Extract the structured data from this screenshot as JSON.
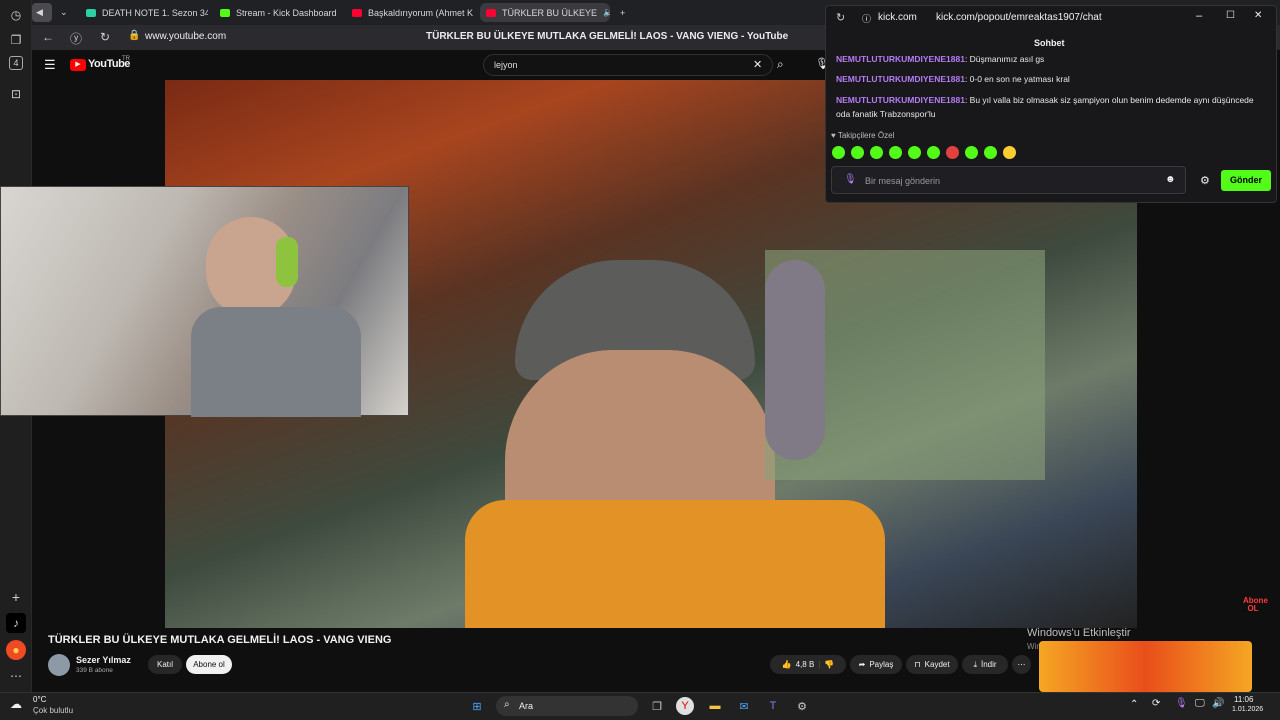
{
  "colors": {
    "yt_red": "#ff0000",
    "kick_green": "#53fc18",
    "chat_user": "#b57cf5"
  },
  "tabs": [
    {
      "label": "DEATH NOTE 1. Sezon 34",
      "icon": "death-note-tab-icon",
      "color": "#2bd1a2"
    },
    {
      "label": "Stream - Kick Dashboard",
      "icon": "kick-icon",
      "color": "#53fc18"
    },
    {
      "label": "Başkaldırıyorum (Ahmet K",
      "icon": "youtube-icon",
      "color": "#ff0033"
    },
    {
      "label": "TÜRKLER BU ÜLKEYE",
      "icon": "youtube-icon",
      "color": "#ff0033"
    }
  ],
  "address": {
    "url": "www.youtube.com",
    "page_title": "TÜRKLER BU ÜLKEYE MUTLAKA GELMELİ! LAOS - VANG VIENG - YouTube"
  },
  "youtube": {
    "logo": "YouTube",
    "country": "TR",
    "search_value": "lejyon"
  },
  "chat_window": {
    "domain": "kick.com",
    "url": "kick.com/popout/emreaktas1907/chat",
    "header": "Sohbet",
    "messages": [
      {
        "user": "NEMUTLUTURKUMDIYENE1881",
        "text": ": Düşmanımız asıl gs"
      },
      {
        "user": "NEMUTLUTURKUMDIYENE1881",
        "text": ": 0-0 en son ne yatması kral"
      },
      {
        "user": "NEMUTLUTURKUMDIYENE1881",
        "text": ": Bu yıl valla biz olmasak siz şampiyon olun benim dedemde aynı düşüncede oda fanatik Trabzonspor'lu"
      }
    ],
    "followers_label": "Takipçilere Özel",
    "emote_count": 10,
    "input_placeholder": "Bir mesaj gönderin",
    "send_label": "Gönder"
  },
  "video": {
    "title": "TÜRKLER BU ÜLKEYE MUTLAKA GELMELİ! LAOS - VANG VIENG",
    "watermark": "Abone OL",
    "channel": "Sezer Yılmaz",
    "subs": "339 B abone",
    "join_label": "Katıl",
    "subscribe_label": "Abone ol",
    "likes": "4,8 B",
    "share_label": "Paylaş",
    "save_label": "Kaydet",
    "download_label": "İndir"
  },
  "windows_activation": {
    "line1": "Windows'u Etkinleştir",
    "line2": "Windows'u"
  },
  "taskbar": {
    "temperature": "0°C",
    "weather": "Çok bulutlu",
    "search_label": "Ara",
    "time": "11:06",
    "date": "1.01.2026"
  },
  "rail": {
    "badge": "4"
  }
}
